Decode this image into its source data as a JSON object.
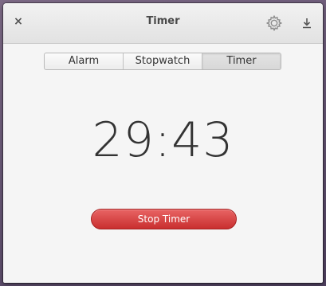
{
  "window": {
    "title": "Timer"
  },
  "titlebar": {
    "close_icon": "×",
    "settings_icon": "gear-icon",
    "download_icon": "download-icon"
  },
  "mode_switcher": {
    "items": [
      {
        "label": "Alarm",
        "active": false
      },
      {
        "label": "Stopwatch",
        "active": false
      },
      {
        "label": "Timer",
        "active": true
      }
    ]
  },
  "timer": {
    "display": "29:43"
  },
  "actions": {
    "stop_label": "Stop Timer"
  },
  "colors": {
    "stop_button": "#d84545",
    "background": "#f5f5f5"
  }
}
